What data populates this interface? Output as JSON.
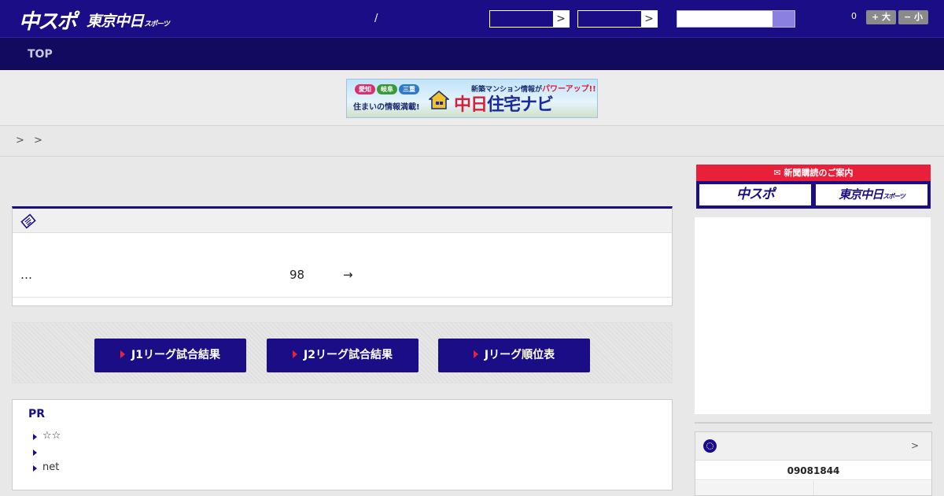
{
  "header": {
    "logo_main": "中スポ",
    "logo_tokyo": "東京中日",
    "logo_tokyo_suffix": "スポーツ",
    "separator": "/",
    "font_count": "0",
    "font_bigger": "+ 大",
    "font_smaller": "− 小",
    "select_arrow": ">",
    "search_placeholder": ""
  },
  "nav": {
    "items": [
      {
        "label": "TOP"
      }
    ]
  },
  "banner": {
    "tags": [
      "愛知",
      "岐阜",
      "三重"
    ],
    "subtitle": "住まいの情報満載!",
    "top_text": "新築マンション情報が",
    "top_power": "パワーアップ!!",
    "main_part1": "中日",
    "main_part2": "住宅ナビ"
  },
  "breadcrumb": "> >",
  "article": {
    "ellipsis": "…",
    "count": "98",
    "arrow": "→"
  },
  "league_buttons": [
    {
      "label": "J1リーグ試合結果"
    },
    {
      "label": "J2リーグ試合結果"
    },
    {
      "label": "Jリーグ順位表"
    }
  ],
  "pr": {
    "title": "PR",
    "items": [
      {
        "text": "☆☆"
      },
      {
        "text": ""
      },
      {
        "text": "net"
      }
    ]
  },
  "subscription": {
    "header": "新聞購読のご案内",
    "chuspo": "中スポ",
    "tokyo": "東京中日",
    "tokyo_suffix": "スポーツ"
  },
  "schedule": {
    "more": ">",
    "date": "09081844"
  },
  "colors": {
    "header_bg": "#1a0d85",
    "nav_bg": "#120a5e",
    "accent_red": "#e8203a",
    "button_bg": "#1a0d85"
  }
}
